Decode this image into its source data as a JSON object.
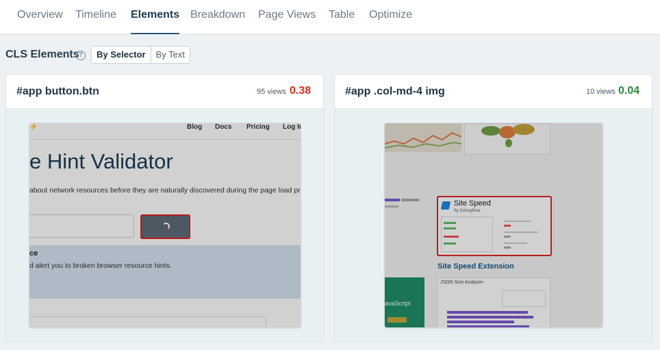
{
  "tabs": [
    "Overview",
    "Timeline",
    "Elements",
    "Breakdown",
    "Page Views",
    "Table",
    "Optimize"
  ],
  "active_tab": "Elements",
  "section": {
    "title": "CLS Elements",
    "help_icon": "question-circle-icon",
    "toggle": {
      "by_selector": "By Selector",
      "by_text": "By Text",
      "active": "By Selector"
    }
  },
  "cards": [
    {
      "selector": "#app button.btn",
      "views": "95 views",
      "score": "0.38",
      "score_color": "#d32f1e",
      "screenshot": {
        "nav": [
          "Blog",
          "Docs",
          "Pricing",
          "Log In"
        ],
        "heading": "e Hint Validator",
        "subtext": "about network resources before they are naturally discovered during the page load pro",
        "section_title": "ce",
        "section_text": "d alert you to broken browser resource hints."
      }
    },
    {
      "selector": "#app .col-md-4 img",
      "views": "10 views",
      "score": "0.04",
      "score_color": "#2b8a3e",
      "screenshot": {
        "ext_title": "Site Speed",
        "ext_subtitle": "By DebugBear",
        "ext_caption": "Site Speed Extension",
        "js_text": "avaScript",
        "json_title": "JSON Size Analyzer"
      }
    }
  ]
}
